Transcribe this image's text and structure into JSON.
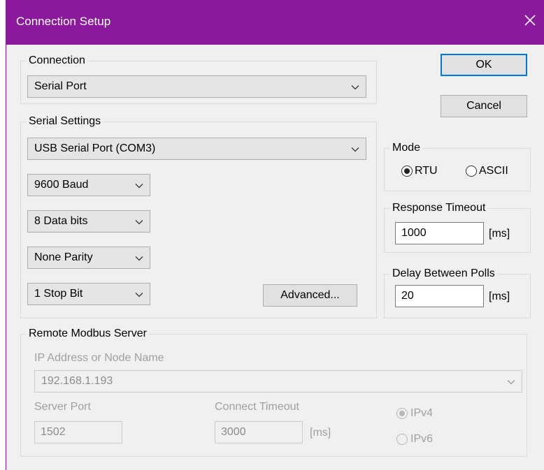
{
  "window": {
    "title": "Connection Setup"
  },
  "connection": {
    "legend": "Connection",
    "selected": "Serial Port"
  },
  "buttons": {
    "ok": "OK",
    "cancel": "Cancel",
    "advanced": "Advanced..."
  },
  "serial": {
    "legend": "Serial Settings",
    "port": "USB Serial Port (COM3)",
    "baud": "9600 Baud",
    "data_bits": "8 Data bits",
    "parity": "None Parity",
    "stop_bits": "1 Stop Bit"
  },
  "mode": {
    "legend": "Mode",
    "options": [
      "RTU",
      "ASCII"
    ],
    "selected": "RTU"
  },
  "response_timeout": {
    "legend": "Response Timeout",
    "value": "1000",
    "unit": "[ms]"
  },
  "delay_between_polls": {
    "legend": "Delay Between Polls",
    "value": "20",
    "unit": "[ms]"
  },
  "remote": {
    "legend": "Remote Modbus Server",
    "ip_label": "IP Address or Node Name",
    "ip_value": "192.168.1.193",
    "port_label": "Server Port",
    "port_value": "1502",
    "timeout_label": "Connect Timeout",
    "timeout_value": "3000",
    "timeout_unit": "[ms]",
    "ip_versions": [
      "IPv4",
      "IPv6"
    ],
    "ip_version_selected": "IPv4"
  },
  "colors": {
    "titlebar": "#8a1a9b",
    "default_button_border": "#0078d7"
  }
}
